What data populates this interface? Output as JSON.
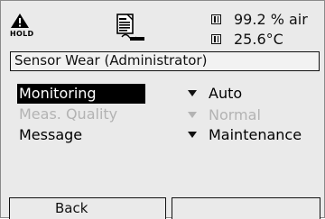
{
  "status": {
    "hold_label": "HOLD",
    "measurements": [
      {
        "value": "99.2 % air"
      },
      {
        "value": "25.6°C"
      }
    ]
  },
  "title": "Sensor Wear (Administrator)",
  "menu": [
    {
      "label": "Monitoring",
      "value": "Auto"
    },
    {
      "label": "Meas. Quality",
      "value": "Normal"
    },
    {
      "label": "Message",
      "value": "Maintenance"
    }
  ],
  "softkeys": {
    "left": "Back",
    "right": ""
  }
}
